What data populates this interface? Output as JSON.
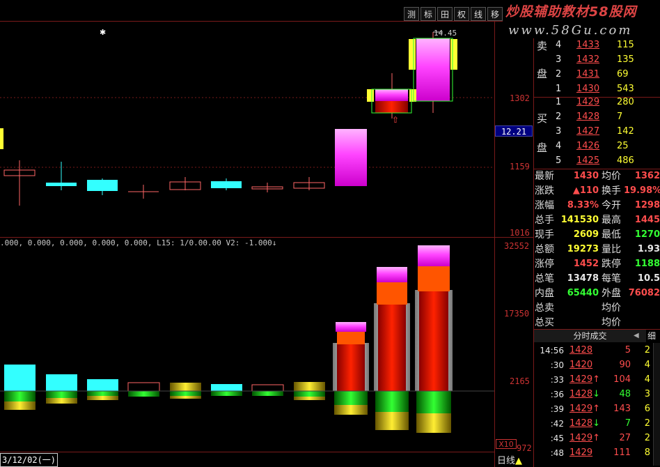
{
  "toolbar": {
    "buttons": [
      "测",
      "标",
      "田",
      "权",
      "线",
      "移"
    ]
  },
  "watermark": {
    "line1": "炒股辅助教材58股网",
    "line2": "www.58Gu.com"
  },
  "chart": {
    "max_label": "14.45",
    "price_ticks": [
      "1302",
      "1159",
      "1016"
    ],
    "current_price_box": "12.21",
    "indicator_line": ".000, 0.000, 0.000, 0.000, 0.000, L15: 1/0.00.00 V2: -1.000↓",
    "volume_ticks": [
      "32552",
      "17350",
      "2165"
    ],
    "zoom_label": "X10",
    "bottom_tick": "972",
    "date_label": "3/12/02(一)",
    "period_label": "日线"
  },
  "orderbook": {
    "sell_label_1": "卖",
    "sell_label_2": "盘",
    "buy_label_1": "买",
    "buy_label_2": "盘",
    "sell": [
      {
        "level": "4",
        "price": "1433",
        "vol": "115"
      },
      {
        "level": "3",
        "price": "1432",
        "vol": "135"
      },
      {
        "level": "2",
        "price": "1431",
        "vol": "69"
      },
      {
        "level": "1",
        "price": "1430",
        "vol": "543"
      }
    ],
    "buy": [
      {
        "level": "1",
        "price": "1429",
        "vol": "280"
      },
      {
        "level": "2",
        "price": "1428",
        "vol": "7"
      },
      {
        "level": "3",
        "price": "1427",
        "vol": "142"
      },
      {
        "level": "4",
        "price": "1426",
        "vol": "25"
      },
      {
        "level": "5",
        "price": "1425",
        "vol": "486"
      }
    ]
  },
  "stats": [
    {
      "l1": "最新",
      "v1": "1430",
      "l2": "均价",
      "v2": "1362"
    },
    {
      "l1": "涨跌",
      "v1": "▲110",
      "l2": "换手",
      "v2": "19.98%"
    },
    {
      "l1": "涨幅",
      "v1": "8.33%",
      "l2": "今开",
      "v2": "1298"
    },
    {
      "l1": "总手",
      "v1": "141530",
      "l2": "最高",
      "v2": "1445"
    },
    {
      "l1": "现手",
      "v1": "2609",
      "l2": "最低",
      "v2": "1270"
    },
    {
      "l1": "总额",
      "v1": "19273",
      "l2": "量比",
      "v2": "1.93"
    },
    {
      "l1": "涨停",
      "v1": "1452",
      "l2": "跌停",
      "v2": "1188"
    },
    {
      "l1": "总笔",
      "v1": "13478",
      "l2": "每笔",
      "v2": "10.5"
    },
    {
      "l1": "内盘",
      "v1": "65440",
      "l2": "外盘",
      "v2": "76082"
    },
    {
      "l1": "总卖",
      "v1": "",
      "l2": "均价",
      "v2": ""
    },
    {
      "l1": "总买",
      "v1": "",
      "l2": "均价",
      "v2": ""
    }
  ],
  "ticks": {
    "title": "分时成交",
    "detail": "细",
    "rows": [
      {
        "time": "14:56",
        "price": "1428",
        "arrow": "",
        "vol": "5",
        "n": "2"
      },
      {
        "time": ":30",
        "price": "1420",
        "arrow": "",
        "vol": "90",
        "n": "4"
      },
      {
        "time": ":33",
        "price": "1429",
        "arrow": "↑",
        "vol": "104",
        "n": "4"
      },
      {
        "time": ":36",
        "price": "1428",
        "arrow": "↓",
        "vol": "48",
        "n": "3"
      },
      {
        "time": ":39",
        "price": "1429",
        "arrow": "↑",
        "vol": "143",
        "n": "6"
      },
      {
        "time": ":42",
        "price": "1428",
        "arrow": "↓",
        "vol": "7",
        "n": "2"
      },
      {
        "time": ":45",
        "price": "1429",
        "arrow": "↑",
        "vol": "27",
        "n": "2"
      },
      {
        "time": ":48",
        "price": "1429",
        "arrow": "",
        "vol": "111",
        "n": "8"
      }
    ]
  },
  "colors": {
    "grid": "#7a1a1a",
    "up": "#ff4d4d",
    "down": "#33ff33",
    "cyan": "#33ffff",
    "magenta": "#ff44ff"
  }
}
